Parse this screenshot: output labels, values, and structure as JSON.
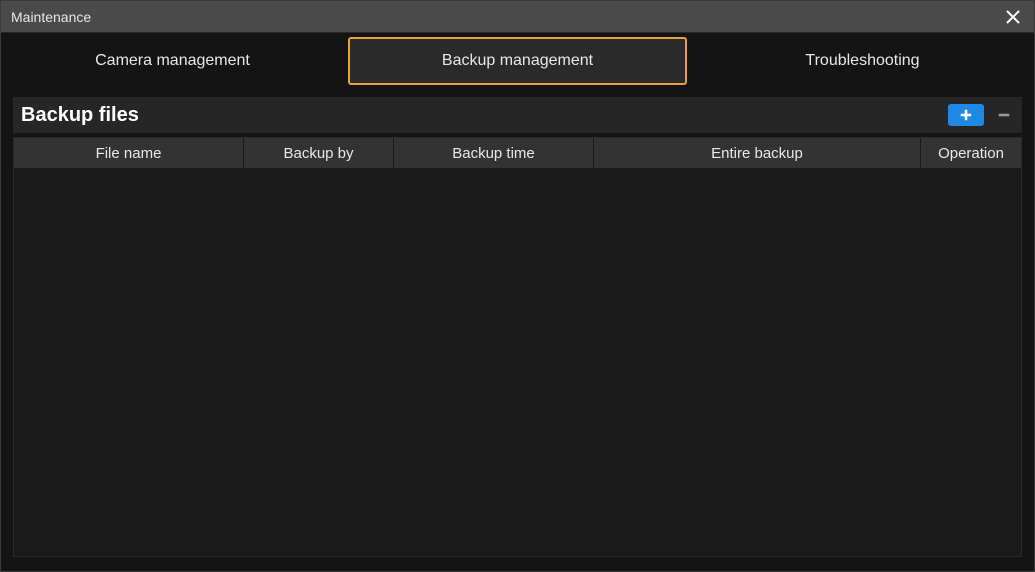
{
  "window": {
    "title": "Maintenance"
  },
  "tabs": {
    "camera": "Camera management",
    "backup": "Backup management",
    "troubleshoot": "Troubleshooting",
    "active": "backup"
  },
  "section": {
    "title": "Backup files"
  },
  "table": {
    "columns": {
      "filename": "File name",
      "backupby": "Backup by",
      "backuptime": "Backup time",
      "entire": "Entire backup",
      "operation": "Operation"
    },
    "rows": []
  },
  "colors": {
    "accent": "#e8a23c",
    "primary": "#1e88e5"
  }
}
